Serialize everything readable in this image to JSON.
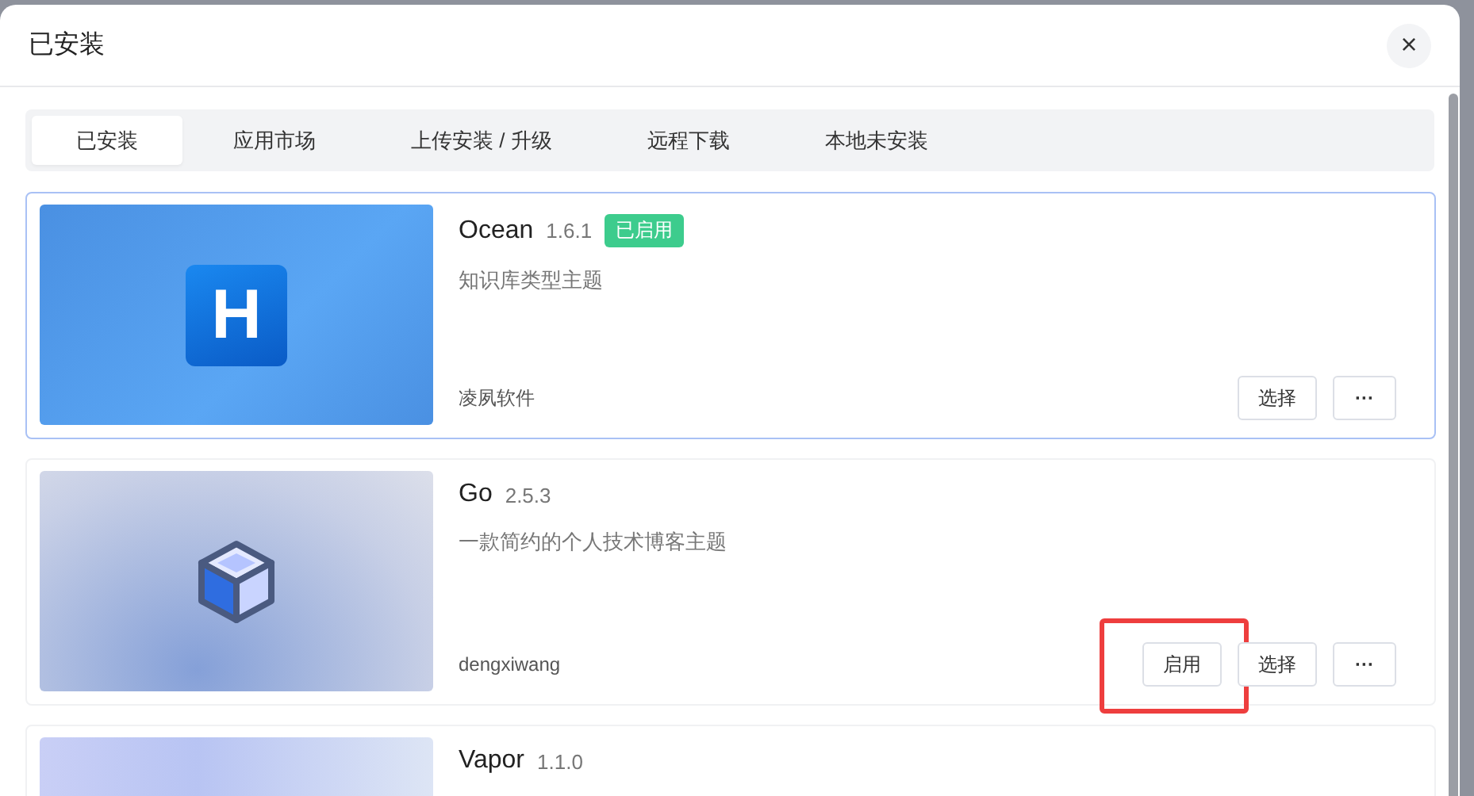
{
  "dialog": {
    "title": "已安装",
    "close": "×"
  },
  "tabs": [
    {
      "label": "已安装",
      "selected": true
    },
    {
      "label": "应用市场",
      "selected": false
    },
    {
      "label": "上传安装 / 升级",
      "selected": false
    },
    {
      "label": "远程下载",
      "selected": false
    },
    {
      "label": "本地未安装",
      "selected": false
    }
  ],
  "themes": [
    {
      "name": "Ocean",
      "version": "1.6.1",
      "badge": "已启用",
      "selected": true,
      "kind": "logo",
      "logo_letter": "H",
      "description": "知识库类型主题",
      "author": "凌夙软件",
      "actions": [
        {
          "kind": "text",
          "label": "选择",
          "highlighted": false
        },
        {
          "kind": "more",
          "label": "···",
          "highlighted": false
        }
      ]
    },
    {
      "name": "Go",
      "version": "2.5.3",
      "selected": false,
      "kind": "cube",
      "description": "一款简约的个人技术博客主题",
      "author": "dengxiwang",
      "actions": [
        {
          "kind": "text",
          "label": "启用",
          "highlighted": true
        },
        {
          "kind": "text",
          "label": "选择",
          "highlighted": false
        },
        {
          "kind": "more",
          "label": "···",
          "highlighted": false
        }
      ]
    },
    {
      "name": "Vapor",
      "version": "1.1.0",
      "selected": false,
      "kind": "plain"
    }
  ]
}
